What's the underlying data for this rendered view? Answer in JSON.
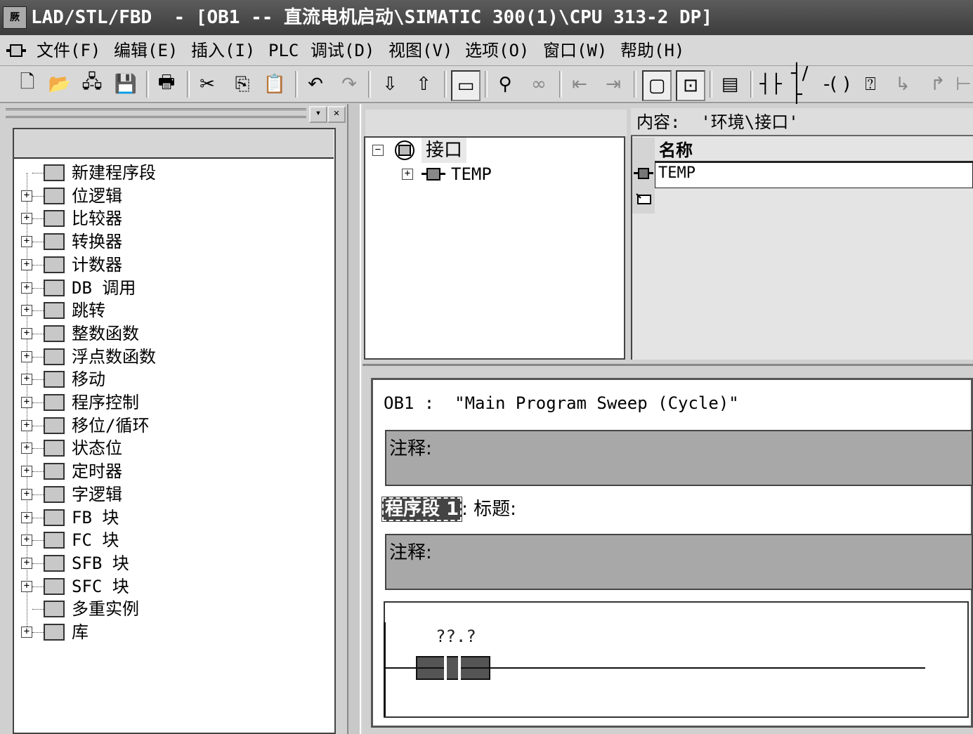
{
  "titlebar": {
    "app_icon": "step7-icon",
    "title": "LAD/STL/FBD  - [OB1 -- 直流电机启动\\SIMATIC 300(1)\\CPU 313-2 DP]"
  },
  "menu": {
    "items": [
      "文件(F)",
      "编辑(E)",
      "插入(I)",
      "PLC",
      "调试(D)",
      "视图(V)",
      "选项(O)",
      "窗口(W)",
      "帮助(H)"
    ]
  },
  "toolbar": {
    "icons": [
      "new-icon",
      "open-icon",
      "accessible-nodes-icon",
      "save-icon",
      "print-icon",
      "cut-icon",
      "copy-icon",
      "paste-icon",
      "undo-icon",
      "redo-icon",
      "download-icon",
      "upload-icon",
      "overview-icon",
      "monitor-icon",
      "glasses-icon",
      "prev-network-icon",
      "next-network-icon",
      "view-window-icon",
      "zoom-window-icon",
      "new-network-icon",
      "no-contact-icon",
      "nc-contact-icon",
      "coil-icon",
      "empty-box-icon",
      "branch-open-icon",
      "branch-close-icon"
    ]
  },
  "left_tree": {
    "items": [
      {
        "label": "新建程序段",
        "icon": "new-network-icon",
        "expandable": false
      },
      {
        "label": "位逻辑",
        "icon": "bit-logic-icon",
        "expandable": true
      },
      {
        "label": "比较器",
        "icon": "comparator-icon",
        "expandable": true
      },
      {
        "label": "转换器",
        "icon": "converter-icon",
        "expandable": true
      },
      {
        "label": "计数器",
        "icon": "counter-icon",
        "expandable": true
      },
      {
        "label": "DB 调用",
        "icon": "db-call-icon",
        "expandable": true
      },
      {
        "label": "跳转",
        "icon": "jump-icon",
        "expandable": true
      },
      {
        "label": "整数函数",
        "icon": "integer-math-icon",
        "expandable": true
      },
      {
        "label": "浮点数函数",
        "icon": "float-math-icon",
        "expandable": true
      },
      {
        "label": "移动",
        "icon": "move-icon",
        "expandable": true
      },
      {
        "label": "程序控制",
        "icon": "program-control-icon",
        "expandable": true
      },
      {
        "label": "移位/循环",
        "icon": "shift-rotate-icon",
        "expandable": true
      },
      {
        "label": "状态位",
        "icon": "status-bits-icon",
        "expandable": true
      },
      {
        "label": "定时器",
        "icon": "timer-icon",
        "expandable": true
      },
      {
        "label": "字逻辑",
        "icon": "word-logic-icon",
        "expandable": true
      },
      {
        "label": "FB 块",
        "icon": "fb-block-icon",
        "expandable": true
      },
      {
        "label": "FC 块",
        "icon": "fc-block-icon",
        "expandable": true
      },
      {
        "label": "SFB 块",
        "icon": "sfb-block-icon",
        "expandable": true
      },
      {
        "label": "SFC 块",
        "icon": "sfc-block-icon",
        "expandable": true
      },
      {
        "label": "多重实例",
        "icon": "multi-instance-icon",
        "expandable": false
      },
      {
        "label": "库",
        "icon": "library-icon",
        "expandable": true
      }
    ]
  },
  "interface": {
    "root_label": "接口",
    "child_label": "TEMP",
    "content_label": "内容:  '环境\\接口'",
    "column_header": "名称",
    "rows": [
      "TEMP"
    ]
  },
  "editor": {
    "block_title": "OB1 :  \"Main Program Sweep (Cycle)\"",
    "comment_label_1": "注释:",
    "network_label": "程序段 1",
    "network_title_suffix": ": 标题:",
    "comment_label_2": "注释:",
    "contact_address": "??.?"
  }
}
